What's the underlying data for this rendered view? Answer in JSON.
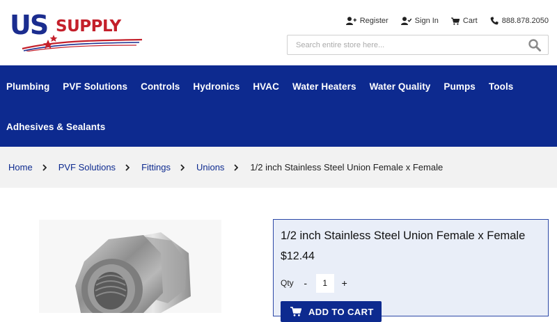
{
  "brand": {
    "part1": "US",
    "part2": "SUPPLY",
    "colors": {
      "blue": "#1b2d8f",
      "red": "#c4202b"
    }
  },
  "topnav": {
    "register": {
      "label": "Register",
      "icon": "user-plus-icon"
    },
    "signin": {
      "label": "Sign In",
      "icon": "user-check-icon"
    },
    "cart": {
      "label": "Cart",
      "icon": "cart-icon"
    },
    "phone": {
      "label": "888.878.2050",
      "icon": "phone-icon"
    }
  },
  "search": {
    "placeholder": "Search entire store here...",
    "value": "",
    "icon": "search-icon"
  },
  "mainnav": {
    "color": "#0d2a8f",
    "items": [
      "Plumbing",
      "PVF Solutions",
      "Controls",
      "Hydronics",
      "HVAC",
      "Water Heaters",
      "Water Quality",
      "Pumps",
      "Tools",
      "Adhesives & Sealants"
    ]
  },
  "breadcrumb": {
    "items": [
      "Home",
      "PVF Solutions",
      "Fittings",
      "Unions"
    ],
    "current": "1/2 inch Stainless Steel Union Female x Female"
  },
  "product": {
    "title": "1/2 inch Stainless Steel Union Female x Female",
    "price": "$12.44",
    "qty_label": "Qty",
    "qty_minus": "-",
    "qty_value": "1",
    "qty_plus": "+",
    "add_to_cart": "ADD TO CART",
    "image": "stainless-steel-union-photo"
  }
}
